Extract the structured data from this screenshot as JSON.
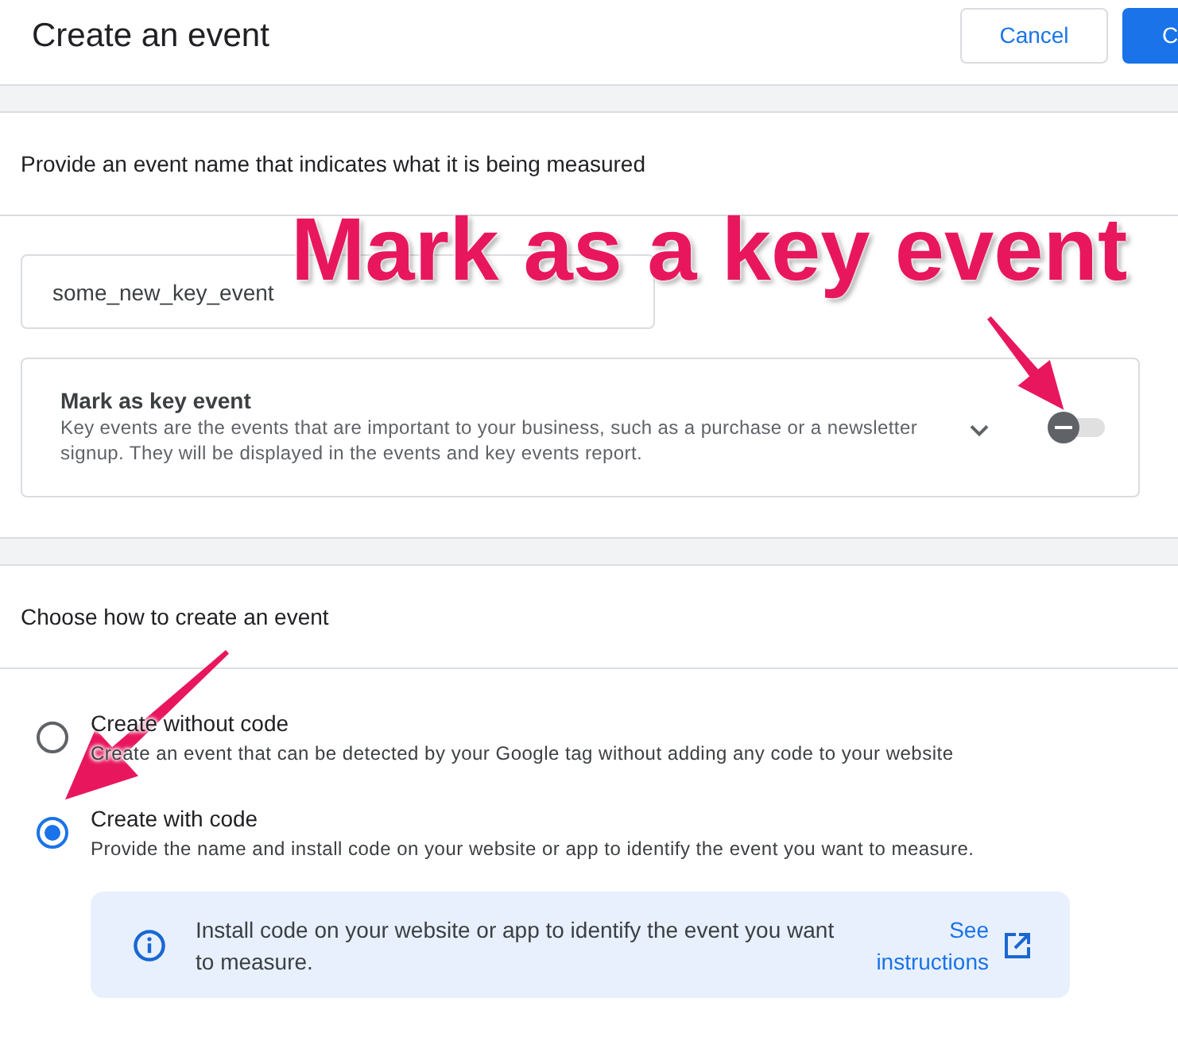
{
  "header": {
    "title": "Create an event",
    "buttons": [
      {
        "label": "Cancel",
        "kind": "outlined"
      },
      {
        "label": "C",
        "kind": "filled"
      }
    ]
  },
  "name_section": {
    "heading": "Provide an event name that indicates what it is being measured",
    "name_field": {
      "value": "some_new_key_event"
    },
    "key_event": {
      "title": "Mark as key event",
      "description": "Key events are the events that are important to your business, such as a purchase or a newsletter signup. They will be displayed in the events and key events report.",
      "on": false
    }
  },
  "method_section": {
    "heading": "Choose how to create an event",
    "options": [
      {
        "title": "Create without code",
        "description": "Create an event that can be detected by your Google tag without adding any code to your website",
        "selected": false
      },
      {
        "title": "Create with code",
        "description": "Provide the name and install code on your website or app to identify the event you want to measure.",
        "selected": true
      }
    ],
    "info": {
      "text": "Install code on your website or app to identify the event you want to measure.",
      "link": "See instructions"
    }
  },
  "annotation": {
    "text": "Mark as a key event"
  }
}
